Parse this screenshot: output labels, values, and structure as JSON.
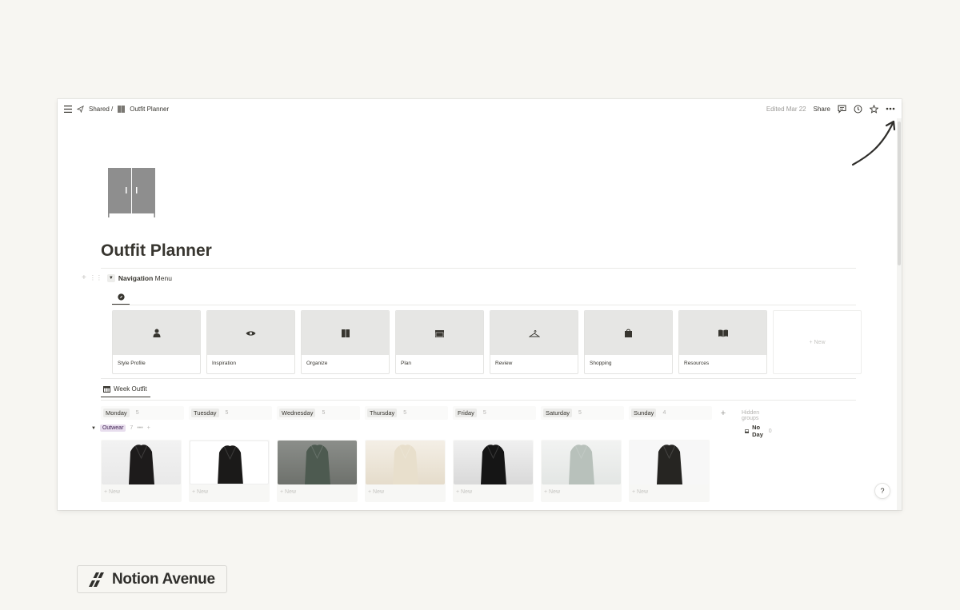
{
  "topbar": {
    "breadcrumb_shared": "Shared /",
    "breadcrumb_page": "Outfit Planner",
    "edited": "Edited Mar 22",
    "share": "Share"
  },
  "page": {
    "title": "Outfit Planner"
  },
  "navigation": {
    "toggle_label_bold": "Navigation",
    "toggle_label_rest": "Menu",
    "cards": [
      {
        "label": "Style Profile",
        "icon": "person-icon"
      },
      {
        "label": "Inspiration",
        "icon": "eye-icon"
      },
      {
        "label": "Organize",
        "icon": "wardrobe-icon"
      },
      {
        "label": "Plan",
        "icon": "calendar-icon"
      },
      {
        "label": "Review",
        "icon": "hanger-icon"
      },
      {
        "label": "Shopping",
        "icon": "bag-icon"
      },
      {
        "label": "Resources",
        "icon": "book-icon"
      }
    ],
    "new_label": "+ New"
  },
  "board": {
    "view_tab": "Week Outfit",
    "columns": [
      {
        "name": "Monday",
        "count": "5"
      },
      {
        "name": "Tuesday",
        "count": "5"
      },
      {
        "name": "Wednesday",
        "count": "5"
      },
      {
        "name": "Thursday",
        "count": "5"
      },
      {
        "name": "Friday",
        "count": "5"
      },
      {
        "name": "Saturday",
        "count": "5"
      },
      {
        "name": "Sunday",
        "count": "4"
      }
    ],
    "hidden_groups": "Hidden groups",
    "no_day": "No Day",
    "no_day_count": "0",
    "group_tag": "Outwear",
    "group_count": "7",
    "new_label": "+ New"
  },
  "colors": {
    "background": "#f7f6f2",
    "cover_gray": "#e6e6e4",
    "tag_purple_bg": "#e8deee"
  },
  "brand": {
    "name": "Notion Avenue"
  },
  "help": "?"
}
